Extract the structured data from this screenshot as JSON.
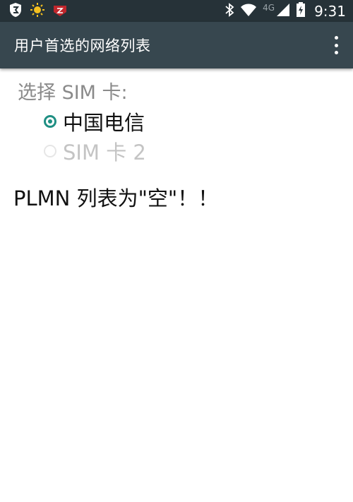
{
  "status_bar": {
    "network_type": "4G",
    "time": "9:31",
    "icons": [
      "shield-icon",
      "weather-sun-icon",
      "zhihu-icon",
      "bluetooth-icon",
      "wifi-icon",
      "signal-icon",
      "battery-charging-icon"
    ]
  },
  "app_bar": {
    "title": "用户首选的网络列表",
    "overflow_icon": "more-vert-icon"
  },
  "sim_select": {
    "label": "选择 SIM 卡:",
    "options": [
      {
        "label": "中国电信",
        "checked": true,
        "enabled": true
      },
      {
        "label": "SIM 卡 2",
        "checked": false,
        "enabled": false
      }
    ]
  },
  "message": "PLMN 列表为\"空\"！！",
  "colors": {
    "status_bar": "#263238",
    "app_bar": "#37474f",
    "accent": "#1f8f83"
  }
}
